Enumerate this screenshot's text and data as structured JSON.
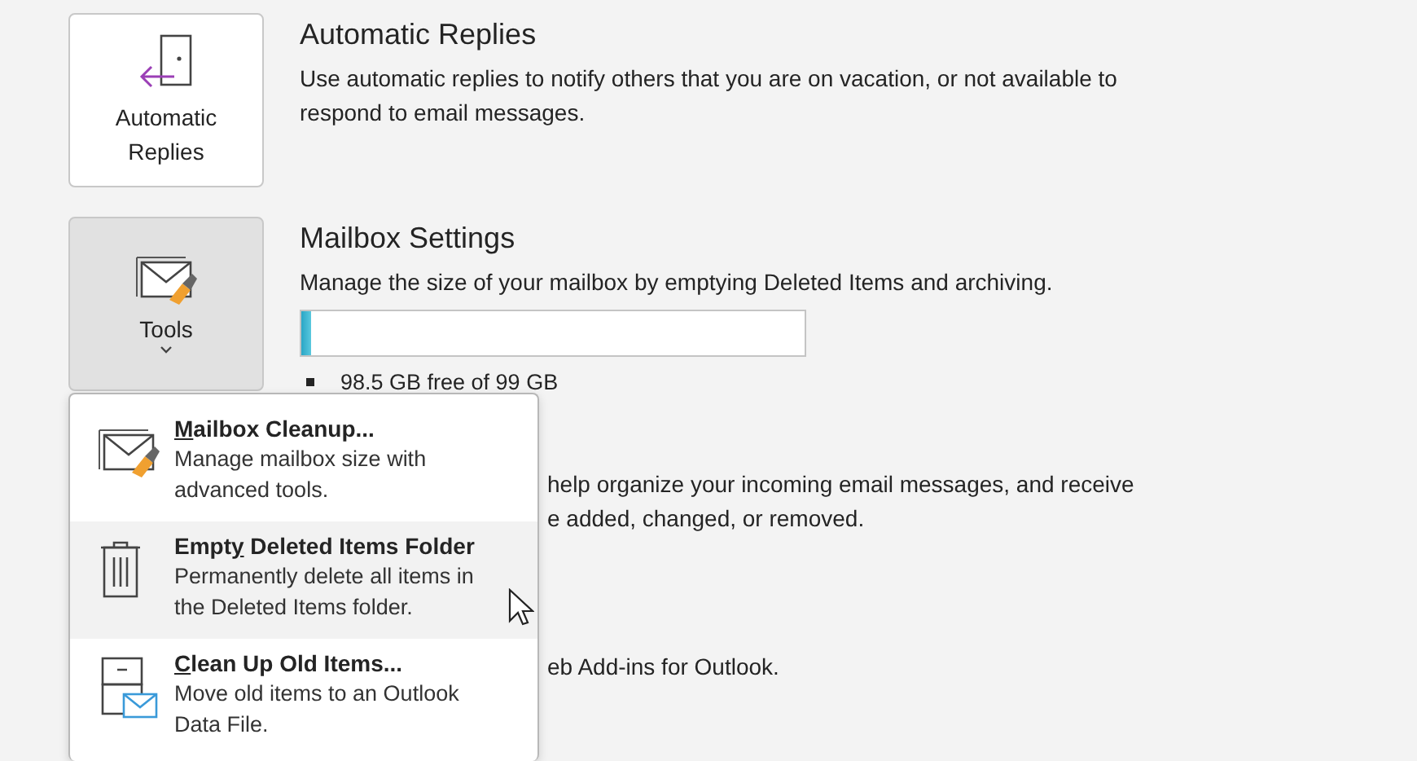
{
  "sections": [
    {
      "kind": "replies",
      "button": {
        "label": "Automatic Replies"
      },
      "title": "Automatic Replies",
      "description": "Use automatic replies to notify others that you are on vacation, or not available to respond to email messages."
    },
    {
      "kind": "mailbox",
      "button": {
        "label": "Tools",
        "pressed": true
      },
      "title": "Mailbox Settings",
      "description": "Manage the size of your mailbox by emptying Deleted Items and archiving.",
      "usage": {
        "level": 0.02,
        "reading": "98.5 GB free of 99 GB"
      }
    },
    {
      "kind": "covered",
      "lines": [
        "help organize your incoming email messages, and receive",
        "e added, changed, or removed."
      ]
    },
    {
      "kind": "covered",
      "lines": [
        "eb Add-ins for Outlook."
      ]
    }
  ],
  "menu": {
    "items": [
      {
        "kind": "cleanup",
        "label": {
          "key": "M",
          "after": "ailbox Cleanup..."
        },
        "description": "Manage mailbox size with advanced tools.",
        "selected": false
      },
      {
        "kind": "trash",
        "label": {
          "before": "Empt",
          "key": "y",
          "after": " Deleted Items Folder"
        },
        "description": "Permanently delete all items in the Deleted Items folder.",
        "selected": true
      },
      {
        "kind": "archive",
        "label": {
          "key": "C",
          "after": "lean Up Old Items..."
        },
        "description": "Move old items to an Outlook Data File.",
        "selected": false
      }
    ]
  }
}
